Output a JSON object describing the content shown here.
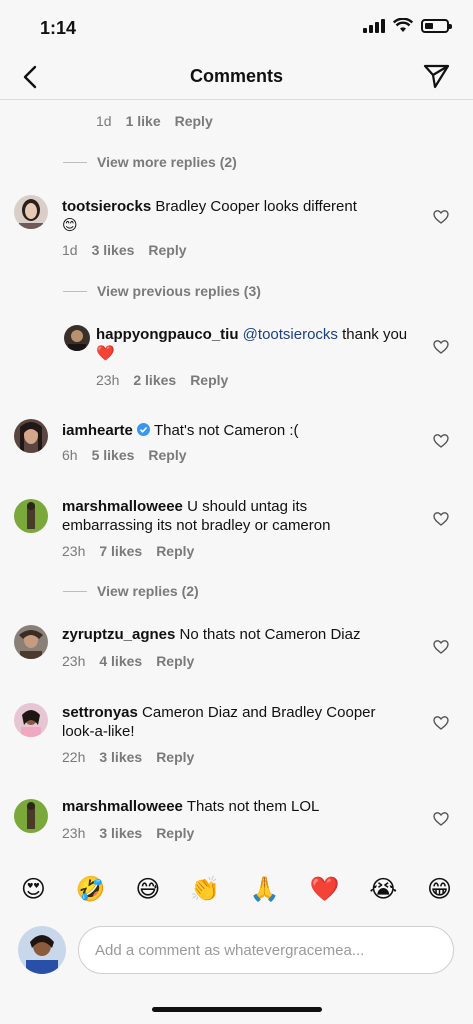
{
  "status": {
    "time": "1:14"
  },
  "header": {
    "title": "Comments",
    "back_icon": "chevron-left-icon",
    "send_icon": "paper-plane-icon"
  },
  "thread_top": {
    "age": "1d",
    "likes": "1 like",
    "reply": "Reply",
    "view_more": "View more replies (2)"
  },
  "comments": [
    {
      "user": "tootsierocks",
      "text": "Bradley Cooper looks different",
      "emoji": "😊",
      "age": "1d",
      "likes": "3 likes",
      "reply": "Reply"
    },
    {
      "view_previous": "View previous replies (3)"
    },
    {
      "user": "happyongpauco_tiu",
      "mention": "@tootsierocks",
      "text": " thank you",
      "emoji": "❤️",
      "age": "23h",
      "likes": "2 likes",
      "reply": "Reply"
    },
    {
      "user": "iamhearte",
      "verified": true,
      "text": "That's not Cameron :(",
      "age": "6h",
      "likes": "5 likes",
      "reply": "Reply"
    },
    {
      "user": "marshmalloweee",
      "text": "U should untag its embarrassing its not bradley or cameron",
      "age": "23h",
      "likes": "7 likes",
      "reply": "Reply",
      "view_replies": "View replies (2)"
    },
    {
      "user": "zyruptzu_agnes",
      "text": "No thats not Cameron Diaz",
      "age": "23h",
      "likes": "4 likes",
      "reply": "Reply"
    },
    {
      "user": "settronyas",
      "text": "Cameron Diaz and Bradley Cooper look-a-like!",
      "age": "22h",
      "likes": "3 likes",
      "reply": "Reply"
    },
    {
      "user": "marshmalloweee",
      "text": "Thats not them LOL",
      "age": "23h",
      "likes": "3 likes",
      "reply": "Reply"
    }
  ],
  "quick_emojis": [
    "😍",
    "🤣",
    "😅",
    "👏",
    "🙏",
    "❤️",
    "😭",
    "😁"
  ],
  "composer": {
    "placeholder": "Add a comment as whatevergracemea..."
  },
  "colors": {
    "mention": "#1d3f83",
    "verified": "#3897f0",
    "meta": "#7a7a7a",
    "heart_emoji": "#e0142b"
  }
}
